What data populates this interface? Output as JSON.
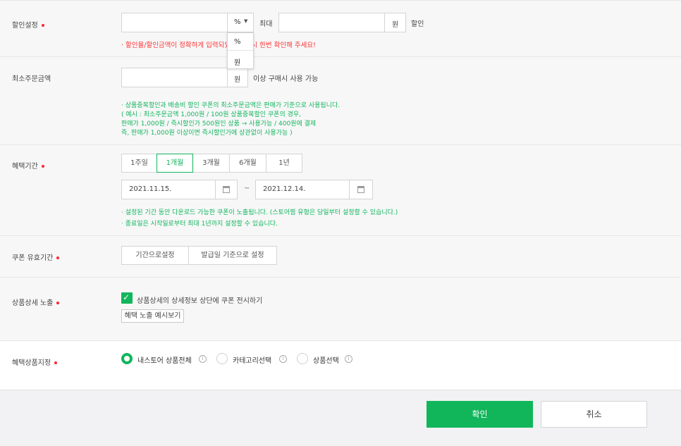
{
  "discount": {
    "label": "할인설정",
    "unit_selected": "%",
    "max_label": "최대",
    "max_unit": "원",
    "suffix": "할인",
    "warning": "· 할인율/할인금액이 정확하게 입력되었는지 다시 한번 확인해 주세요!",
    "dropdown_options": [
      "%",
      "원"
    ]
  },
  "min_order": {
    "label": "최소주문금액",
    "unit": "원",
    "suffix": "이상 구매시 사용 가능",
    "notes": [
      "· 상품중복할인과 배송비 할인 쿠폰의 최소주문금액은 판매가 기준으로 사용됩니다.",
      "( 예시 : 최소주문금액 1,000원 / 100원 상품중복할인 쿠폰의 경우,",
      "판매가 1,000원 / 즉시할인가 500원인 상품 → 사용가능 / 400원에 결제",
      "즉, 판매가 1,000원 이상이면 즉시할인가에 상관없이 사용가능 )"
    ]
  },
  "benefit_period": {
    "label": "혜택기간",
    "options": [
      "1주일",
      "1개월",
      "3개월",
      "6개월",
      "1년"
    ],
    "selected_index": 1,
    "start_date": "2021.11.15.",
    "tilde": "~",
    "end_date": "2021.12.14.",
    "notes": [
      "· 설정된 기간 동안 다운로드 가능한 쿠폰이 노출됩니다. (스토어찜 유형은 당일부터 설정할 수 있습니다.)",
      "· 종료일은 시작일로부터 최대 1년까지 설정할 수 있습니다."
    ]
  },
  "coupon_validity": {
    "label": "쿠폰 유효기간",
    "options": [
      "기간으로설정",
      "발급일 기준으로 설정"
    ]
  },
  "detail_exposure": {
    "label": "상품상세 노출",
    "checkbox_label": "상품상세의 상세정보 상단에 쿠폰 전시하기",
    "checked": true,
    "preview_button": "혜택 노출 예시보기"
  },
  "target_products": {
    "label": "혜택상품지정",
    "options": [
      "내스토어 상품전체",
      "카테고리선택",
      "상품선택"
    ],
    "selected_index": 0,
    "info_glyph": "i"
  },
  "footer": {
    "confirm": "확인",
    "cancel": "취소"
  },
  "colors": {
    "accent": "#11b65b",
    "required_dot": "#ff2233",
    "warning": "#ff3333"
  }
}
